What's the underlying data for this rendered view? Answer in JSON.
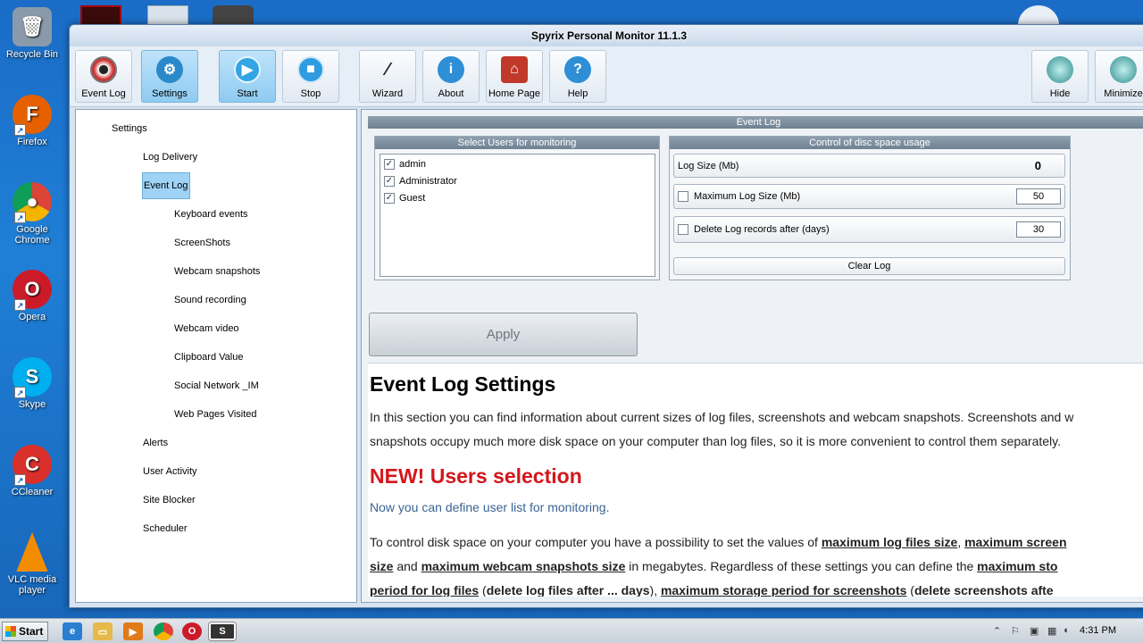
{
  "desktop": {
    "icons": [
      {
        "name": "recycle-bin",
        "label": "Recycle Bin",
        "color": "#8a9aab"
      },
      {
        "name": "firefox",
        "label": "Firefox",
        "color": "#e66000"
      },
      {
        "name": "google-chrome",
        "label": "Google Chrome",
        "color": "#1da462"
      },
      {
        "name": "opera",
        "label": "Opera",
        "color": "#cc1b28"
      },
      {
        "name": "skype",
        "label": "Skype",
        "color": "#00aff0"
      },
      {
        "name": "ccleaner",
        "label": "CCleaner",
        "color": "#d9302b"
      },
      {
        "name": "vlc",
        "label": "VLC media player",
        "color": "#f28c00"
      }
    ]
  },
  "window": {
    "title": "Spyrix Personal Monitor 11.1.3"
  },
  "toolbar": {
    "buttons": [
      {
        "label": "Event Log",
        "icon": "eye-icon"
      },
      {
        "label": "Settings",
        "icon": "gear-icon"
      },
      {
        "label": "Start",
        "icon": "play-icon"
      },
      {
        "label": "Stop",
        "icon": "stop-icon"
      },
      {
        "label": "Wizard",
        "icon": "wand-icon"
      },
      {
        "label": "About",
        "icon": "info-icon"
      },
      {
        "label": "Home Page",
        "icon": "home-icon"
      },
      {
        "label": "Help",
        "icon": "help-icon"
      },
      {
        "label": "Hide",
        "icon": "hide-icon"
      },
      {
        "label": "Minimize",
        "icon": "minimize-icon"
      }
    ]
  },
  "tree": {
    "root": "Settings",
    "items": [
      "Log Delivery",
      "Event Log",
      "Keyboard events",
      "ScreenShots",
      "Webcam snapshots",
      "Sound recording",
      "Webcam video",
      "Clipboard Value",
      "Social Network _IM",
      "Web Pages Visited",
      "Alerts",
      "User Activity",
      "Site Blocker",
      "Scheduler"
    ],
    "selected": "Event Log"
  },
  "event_log": {
    "header": "Event Log",
    "users_group": {
      "title": "Select Users for monitoring",
      "users": [
        {
          "name": "admin",
          "checked": true
        },
        {
          "name": "Administrator",
          "checked": true
        },
        {
          "name": "Guest",
          "checked": true
        }
      ]
    },
    "disk_group": {
      "title": "Control of disc space usage",
      "log_size_label": "Log Size (Mb)",
      "log_size_value": "0",
      "max_log_label": "Maximum Log Size (Mb)",
      "max_log_value": "50",
      "delete_label": "Delete Log records after (days)",
      "delete_value": "30",
      "clear_label": "Clear Log"
    },
    "apply_label": "Apply"
  },
  "doc": {
    "title": "Event Log Settings",
    "intro_1": "In this section you can find information about current sizes of log files, screenshots and webcam snapshots. Screenshots and w",
    "intro_2": "snapshots occupy much more disk space on your computer than log files, so it is more convenient to control them separately.",
    "new_heading": "NEW! Users selection",
    "new_text": "Now you can define user list for monitoring.",
    "p1_a": "To control disk space on your computer you have a possibility to set the values of ",
    "p1_b": "maximum log files size",
    "p1_c": ", ",
    "p1_d": "maximum screen",
    "p2_a": "size",
    "p2_b": " and  ",
    "p2_c": "maximum webcam snapshots size",
    "p2_d": " in megabytes. Regardless of these settings you can define the ",
    "p2_e": "maximum sto",
    "p3_a": "period for log files",
    "p3_b": " (",
    "p3_c": "delete log files after ... days",
    "p3_d": "), ",
    "p3_e": "maximum storage period for screenshots",
    "p3_f": " (",
    "p3_g": "delete screenshots afte"
  },
  "taskbar": {
    "start_label": "Start",
    "clock": "4:31 PM"
  }
}
